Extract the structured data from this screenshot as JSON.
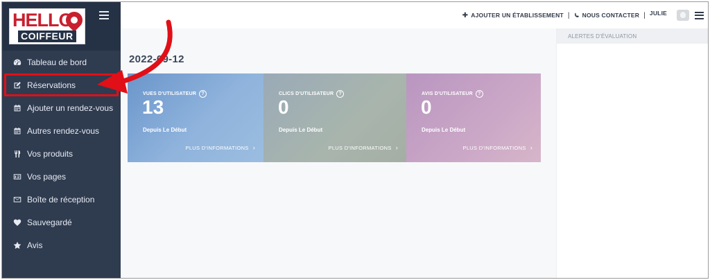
{
  "brand": {
    "logo_text_top": "HELLO",
    "logo_text_bottom": "COIFFEUR"
  },
  "sidebar": {
    "items": [
      {
        "label": "Tableau de bord",
        "icon": "dashboard-icon"
      },
      {
        "label": "Réservations",
        "icon": "edit-icon"
      },
      {
        "label": "Ajouter un rendez-vous",
        "icon": "calendar-icon"
      },
      {
        "label": "Autres rendez-vous",
        "icon": "calendar-icon"
      },
      {
        "label": "Vos produits",
        "icon": "cutlery-icon"
      },
      {
        "label": "Vos pages",
        "icon": "id-card-icon"
      },
      {
        "label": "Boîte de réception",
        "icon": "envelope-icon"
      },
      {
        "label": "Sauvegardé",
        "icon": "heart-icon"
      },
      {
        "label": "Avis",
        "icon": "star-icon"
      }
    ]
  },
  "topbar": {
    "add_establishment": "AJOUTER UN ÉTABLISSEMENT",
    "contact": "NOUS CONTACTER",
    "user_name": "JULIE",
    "separator": "|"
  },
  "main": {
    "date": "2022-09-12",
    "cards": [
      {
        "label": "VUES D'UTILISATEUR",
        "value": "13",
        "since": "Depuis Le Début",
        "more": "PLUS D'INFORMATIONS"
      },
      {
        "label": "CLICS D'UTILISATEUR",
        "value": "0",
        "since": "Depuis Le Début",
        "more": "PLUS D'INFORMATIONS"
      },
      {
        "label": "AVIS D'UTILISATEUR",
        "value": "0",
        "since": "Depuis Le Début",
        "more": "PLUS D'INFORMATIONS"
      }
    ],
    "help_glyph": "?",
    "chevron_glyph": "›"
  },
  "right_panel": {
    "title": "ALERTES D'ÉVALUATION"
  },
  "colors": {
    "sidebar_bg": "#2f3b4f",
    "highlight_red": "#e10f17",
    "brand_red": "#c8202f"
  }
}
